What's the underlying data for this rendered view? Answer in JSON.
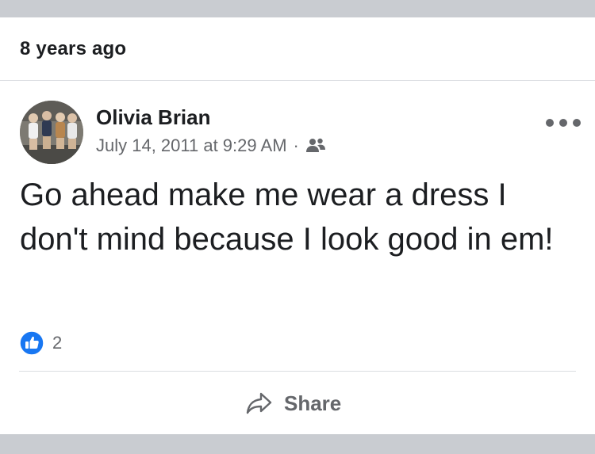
{
  "memory": {
    "label": "8 years ago"
  },
  "post": {
    "author": "Olivia Brian",
    "timestamp": "July 14, 2011 at 9:29 AM",
    "separator": "·",
    "audience_icon": "friends-icon",
    "text": "Go ahead make me wear a dress I don't mind because I look good in em!",
    "more_icon": "more-options-icon"
  },
  "reactions": {
    "icon": "like-icon",
    "count": "2"
  },
  "actions": {
    "share_label": "Share",
    "share_icon": "share-arrow-icon"
  },
  "colors": {
    "like_blue": "#1877f2",
    "secondary_text": "#65676b",
    "band_gray": "#c9ccd1"
  }
}
